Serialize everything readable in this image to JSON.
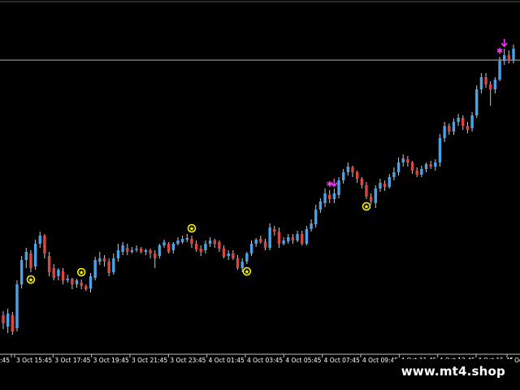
{
  "chart_data": {
    "type": "candlestick",
    "colors": {
      "background": "#000000",
      "bull": "#4aa3e8",
      "bear": "#d9473f",
      "wick": "#c8c8c8",
      "axis": "#c0c0c0",
      "text": "#ffffff",
      "line": "#c8c8c8",
      "star": "#ffff00",
      "magenta": "#ff33ff"
    },
    "x_tick_labels": [
      "3 Oct 15:45",
      "3 Oct 17:45",
      "3 Oct 19:45",
      "3 Oct 21:45",
      "3 Oct 23:45",
      "4 Oct 01:45",
      "4 Oct 03:45",
      "4 Oct 05:45",
      "4 Oct 07:45",
      "4 Oct 09:45",
      "4 Oct 11:45",
      "4 Oct 13:45",
      "4 Oct 15:45"
    ],
    "leading_partial_label": ":45",
    "trailing_partial_label": "4 Oct",
    "candles": [
      [
        388,
        398,
        383,
        405
      ],
      [
        402,
        386,
        380,
        410
      ],
      [
        388,
        408,
        384,
        412
      ],
      [
        404,
        350,
        345,
        408
      ],
      [
        350,
        320,
        315,
        355
      ],
      [
        320,
        310,
        305,
        330
      ],
      [
        312,
        330,
        308,
        335
      ],
      [
        328,
        300,
        295,
        332
      ],
      [
        300,
        290,
        285,
        305
      ],
      [
        290,
        312,
        288,
        318
      ],
      [
        315,
        335,
        310,
        340
      ],
      [
        330,
        342,
        325,
        345
      ],
      [
        340,
        332,
        330,
        345
      ],
      [
        334,
        345,
        330,
        350
      ],
      [
        345,
        343,
        338,
        348
      ],
      [
        343,
        350,
        342,
        356
      ],
      [
        350,
        345,
        343,
        354
      ],
      [
        348,
        352,
        344,
        356
      ],
      [
        352,
        356,
        350,
        358
      ],
      [
        355,
        340,
        336,
        360
      ],
      [
        342,
        320,
        316,
        345
      ],
      [
        322,
        318,
        310,
        326
      ],
      [
        318,
        322,
        314,
        328
      ],
      [
        322,
        336,
        318,
        340
      ],
      [
        335,
        318,
        312,
        338
      ],
      [
        318,
        308,
        300,
        322
      ],
      [
        310,
        302,
        298,
        314
      ],
      [
        305,
        310,
        300,
        314
      ],
      [
        310,
        308,
        304,
        312
      ],
      [
        307,
        306,
        302,
        310
      ],
      [
        306,
        310,
        304,
        312
      ],
      [
        310,
        308,
        306,
        314
      ],
      [
        308,
        312,
        306,
        318
      ],
      [
        312,
        318,
        308,
        330
      ],
      [
        315,
        302,
        300,
        318
      ],
      [
        302,
        298,
        295,
        305
      ],
      [
        300,
        310,
        298,
        312
      ],
      [
        308,
        300,
        298,
        312
      ],
      [
        300,
        296,
        292,
        302
      ],
      [
        298,
        294,
        290,
        300
      ],
      [
        295,
        293,
        288,
        298
      ],
      [
        294,
        300,
        290,
        305
      ],
      [
        300,
        307,
        296,
        310
      ],
      [
        306,
        310,
        302,
        315
      ],
      [
        308,
        300,
        296,
        312
      ],
      [
        300,
        296,
        292,
        304
      ],
      [
        296,
        300,
        294,
        305
      ],
      [
        298,
        306,
        296,
        310
      ],
      [
        306,
        316,
        302,
        318
      ],
      [
        315,
        312,
        308,
        320
      ],
      [
        312,
        318,
        308,
        320
      ],
      [
        318,
        330,
        314,
        332
      ],
      [
        330,
        322,
        318,
        335
      ],
      [
        322,
        312,
        310,
        325
      ],
      [
        312,
        300,
        296,
        315
      ],
      [
        300,
        295,
        293,
        304
      ],
      [
        294,
        298,
        290,
        300
      ],
      [
        297,
        305,
        294,
        308
      ],
      [
        305,
        280,
        275,
        308
      ],
      [
        282,
        285,
        278,
        290
      ],
      [
        285,
        300,
        280,
        305
      ],
      [
        300,
        296,
        292,
        302
      ],
      [
        297,
        292,
        288,
        300
      ],
      [
        292,
        296,
        288,
        300
      ],
      [
        296,
        288,
        284,
        298
      ],
      [
        288,
        300,
        284,
        302
      ],
      [
        300,
        282,
        278,
        302
      ],
      [
        282,
        275,
        270,
        285
      ],
      [
        276,
        258,
        252,
        280
      ],
      [
        258,
        248,
        244,
        262
      ],
      [
        250,
        238,
        232,
        255
      ],
      [
        240,
        245,
        234,
        250
      ],
      [
        245,
        238,
        232,
        250
      ],
      [
        240,
        222,
        218,
        244
      ],
      [
        222,
        212,
        208,
        226
      ],
      [
        212,
        205,
        200,
        216
      ],
      [
        206,
        212,
        204,
        218
      ],
      [
        212,
        220,
        210,
        225
      ],
      [
        220,
        228,
        218,
        232
      ],
      [
        228,
        242,
        224,
        245
      ],
      [
        242,
        248,
        238,
        252
      ],
      [
        250,
        232,
        228,
        256
      ],
      [
        232,
        225,
        220,
        236
      ],
      [
        226,
        230,
        222,
        235
      ],
      [
        230,
        218,
        214,
        232
      ],
      [
        218,
        212,
        206,
        222
      ],
      [
        212,
        200,
        194,
        216
      ],
      [
        200,
        195,
        190,
        205
      ],
      [
        196,
        200,
        192,
        205
      ],
      [
        200,
        210,
        198,
        214
      ],
      [
        210,
        215,
        206,
        218
      ],
      [
        215,
        208,
        204,
        218
      ],
      [
        208,
        202,
        200,
        212
      ],
      [
        202,
        205,
        198,
        208
      ],
      [
        205,
        200,
        196,
        210
      ],
      [
        200,
        170,
        165,
        205
      ],
      [
        170,
        155,
        150,
        175
      ],
      [
        155,
        162,
        152,
        166
      ],
      [
        162,
        150,
        146,
        166
      ],
      [
        150,
        145,
        140,
        155
      ],
      [
        145,
        155,
        142,
        160
      ],
      [
        155,
        160,
        150,
        164
      ],
      [
        158,
        142,
        138,
        162
      ],
      [
        142,
        110,
        105,
        145
      ],
      [
        110,
        95,
        90,
        115
      ],
      [
        95,
        104,
        90,
        108
      ],
      [
        104,
        110,
        100,
        130
      ],
      [
        110,
        98,
        95,
        115
      ],
      [
        98,
        75,
        70,
        100
      ],
      [
        75,
        68,
        60,
        80
      ],
      [
        68,
        75,
        62,
        78
      ],
      [
        74,
        60,
        55,
        78
      ],
      [
        60,
        55,
        50,
        65
      ],
      [
        55,
        50,
        45,
        60
      ]
    ],
    "visible_candle_count": 112,
    "stars_yellow": [
      6,
      17,
      41,
      53,
      79
    ],
    "stars_magenta": [
      71,
      108
    ],
    "arrows_magenta": [
      72,
      109
    ]
  },
  "watermark": {
    "text": "www.mt4.shop"
  }
}
